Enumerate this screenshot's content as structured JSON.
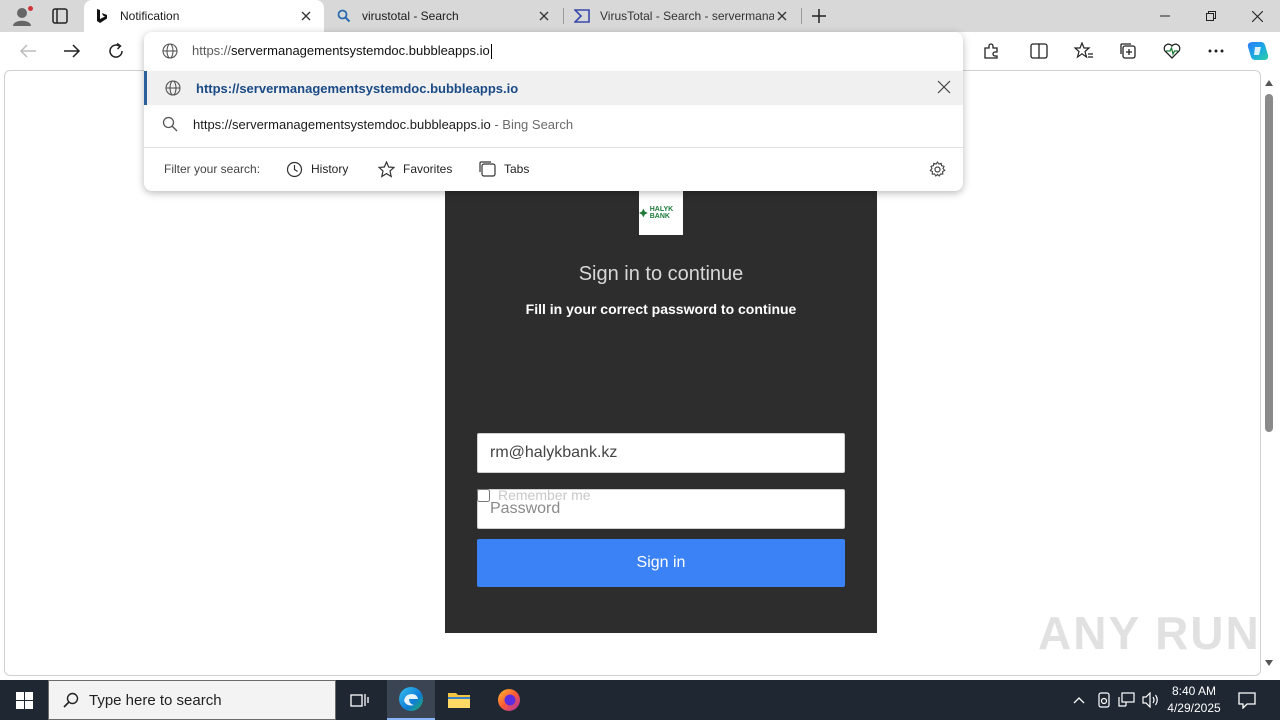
{
  "tabs": [
    {
      "title": "Notification",
      "icon": "bing-icon",
      "active": true
    },
    {
      "title": "virustotal - Search",
      "icon": "search-icon",
      "active": false
    },
    {
      "title": "VirusTotal - Search - servermanag",
      "icon": "virustotal-icon",
      "active": false
    }
  ],
  "omnibox": {
    "protocol": "https://",
    "host": "servermanagementsystemdoc.bubbleapps.io",
    "suggestions": [
      {
        "text": "https://servermanagementsystemdoc.bubbleapps.io",
        "hint": ""
      },
      {
        "text": "https://servermanagementsystemdoc.bubbleapps.io",
        "hint": " - Bing Search"
      }
    ],
    "filter_label": "Filter your search:",
    "filters": [
      "History",
      "Favorites",
      "Tabs"
    ]
  },
  "page": {
    "logo_text": "HALYK BANK",
    "title": "Sign in to continue",
    "subtitle": "Fill in your correct password to continue",
    "email_value": "rm@halykbank.kz",
    "password_placeholder": "Password",
    "remember_label": "Remember me",
    "signin_label": "Sign in",
    "watermark": "ANY RUN"
  },
  "taskbar": {
    "search_placeholder": "Type here to search",
    "time": "8:40 AM",
    "date": "4/29/2025"
  },
  "colors": {
    "card_bg": "#2d2d2d",
    "signin_button": "#3b82f6",
    "taskbar_bg": "#1f2733",
    "tabstrip_bg": "#d8d8d8"
  }
}
